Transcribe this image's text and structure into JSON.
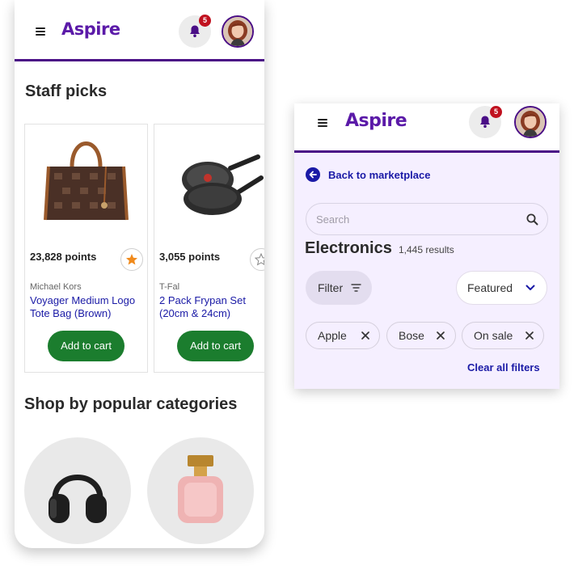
{
  "colors": {
    "brand": "#5b1aa8",
    "accent_border": "#4a0e86",
    "link": "#1a1aa6",
    "cart_button": "#1b7d2e",
    "badge": "#c0111f"
  },
  "phone_main": {
    "header": {
      "logo": "Aspire",
      "notifications": "5"
    },
    "staff_picks": {
      "title": "Staff picks",
      "products": [
        {
          "points": "23,828 points",
          "brand": "Michael Kors",
          "name": "Voyager Medium Logo Tote Bag (Brown)",
          "button": "Add to cart",
          "favorited": true
        },
        {
          "points": "3,055 points",
          "brand": "T-Fal",
          "name": "2 Pack Frypan Set (20cm & 24cm)",
          "button": "Add to cart",
          "favorited": false
        }
      ]
    },
    "categories": {
      "title": "Shop by popular categories",
      "items": [
        {
          "icon": "headphones-icon"
        },
        {
          "icon": "perfume-icon"
        }
      ]
    }
  },
  "phone_filters": {
    "header": {
      "logo": "Aspire",
      "notifications": "5"
    },
    "back_label": "Back to marketplace",
    "search": {
      "placeholder": "Search",
      "value": ""
    },
    "category": "Electronics",
    "results": "1,445 results",
    "filter_label": "Filter",
    "sort": {
      "selected": "Featured"
    },
    "chips": [
      "Apple",
      "Bose",
      "On sale"
    ],
    "clear_label": "Clear all filters"
  }
}
